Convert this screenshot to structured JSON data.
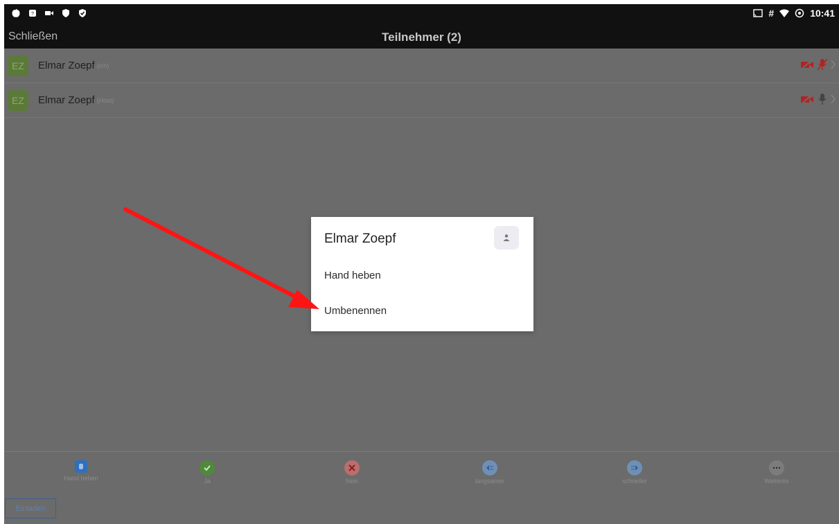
{
  "status_bar": {
    "time": "10:41",
    "hash": "#",
    "left_icons": [
      "apple-icon",
      "shield-badge-icon",
      "video-icon",
      "shield-icon",
      "shield-check-icon"
    ],
    "right_icons": [
      "cast-icon",
      "wifi-icon",
      "data-saver-icon"
    ]
  },
  "header": {
    "close_label": "Schließen",
    "title": "Teilnehmer (2)"
  },
  "participants": [
    {
      "initials": "EZ",
      "name": "Elmar Zoepf",
      "tag": "(ich)",
      "mic": "mic-off-icon",
      "video": "video-off-icon"
    },
    {
      "initials": "EZ",
      "name": "Elmar Zoepf",
      "tag": "(Host)",
      "mic": "mic-icon",
      "video": "video-off-icon"
    }
  ],
  "toolbar": {
    "items": [
      {
        "label": "Hand heben",
        "icon": "hand-icon",
        "color": "#2f6fbd"
      },
      {
        "label": "Ja",
        "icon": "check-icon",
        "color": "#4f8a3a"
      },
      {
        "label": "Nein",
        "icon": "x-icon",
        "color": "#c0504d"
      },
      {
        "label": "langsamer",
        "icon": "slower-icon",
        "color": "#4f7cb0"
      },
      {
        "label": "schneller",
        "icon": "faster-icon",
        "color": "#4f7cb0"
      },
      {
        "label": "Weiteres",
        "icon": "more-icon",
        "color": "#7a7a7a"
      }
    ],
    "invite_label": "Einladen"
  },
  "dialog": {
    "title": "Elmar Zoepf",
    "items": [
      "Hand heben",
      "Umbenennen"
    ]
  },
  "colors": {
    "overlay": "#6b6b6b",
    "header": "#111111",
    "annotation_arrow": "#ff0000",
    "muted_red": "#c0392b"
  }
}
